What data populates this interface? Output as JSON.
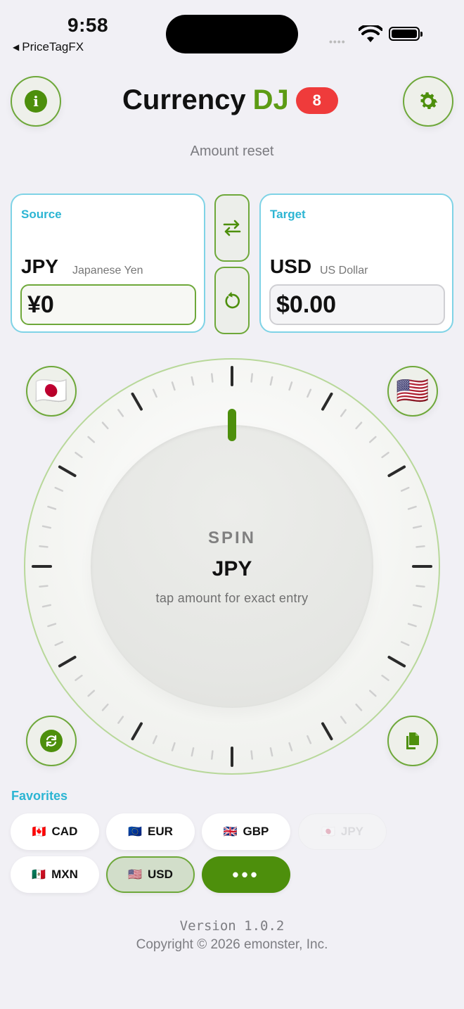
{
  "status_bar": {
    "time": "9:58",
    "back_app": "PriceTagFX"
  },
  "header": {
    "title_main": "Currency",
    "title_accent": "DJ",
    "badge": "8"
  },
  "subtitle": "Amount reset",
  "source": {
    "label": "Source",
    "code": "JPY",
    "name": "Japanese Yen",
    "amount": "¥0"
  },
  "target": {
    "label": "Target",
    "code": "USD",
    "name": "US Dollar",
    "amount": "$0.00"
  },
  "dial": {
    "spin_label": "SPIN",
    "currency": "JPY",
    "hint": "tap amount for exact entry"
  },
  "corner_flags": {
    "source_flag": "🇯🇵",
    "target_flag": "🇺🇸"
  },
  "favorites": {
    "title": "Favorites",
    "chips": [
      {
        "flag": "🇨🇦",
        "code": "CAD"
      },
      {
        "flag": "🇪🇺",
        "code": "EUR"
      },
      {
        "flag": "🇬🇧",
        "code": "GBP"
      },
      {
        "flag": "🇯🇵",
        "code": "JPY"
      },
      {
        "flag": "🇲🇽",
        "code": "MXN"
      },
      {
        "flag": "🇺🇸",
        "code": "USD"
      }
    ],
    "more_label": "•••"
  },
  "footer": {
    "version": "Version 1.0.2",
    "copyright": "Copyright © 2026 emonster, Inc."
  },
  "colors": {
    "accent_green": "#4d8f0c",
    "accent_cyan": "#2cb5d3",
    "badge_red": "#ef3b3b"
  },
  "icons": {
    "info": "info-icon",
    "settings": "gear-icon",
    "swap": "swap-arrows-icon",
    "reset": "reset-icon",
    "sync": "sync-icon",
    "copy": "copy-icon"
  }
}
